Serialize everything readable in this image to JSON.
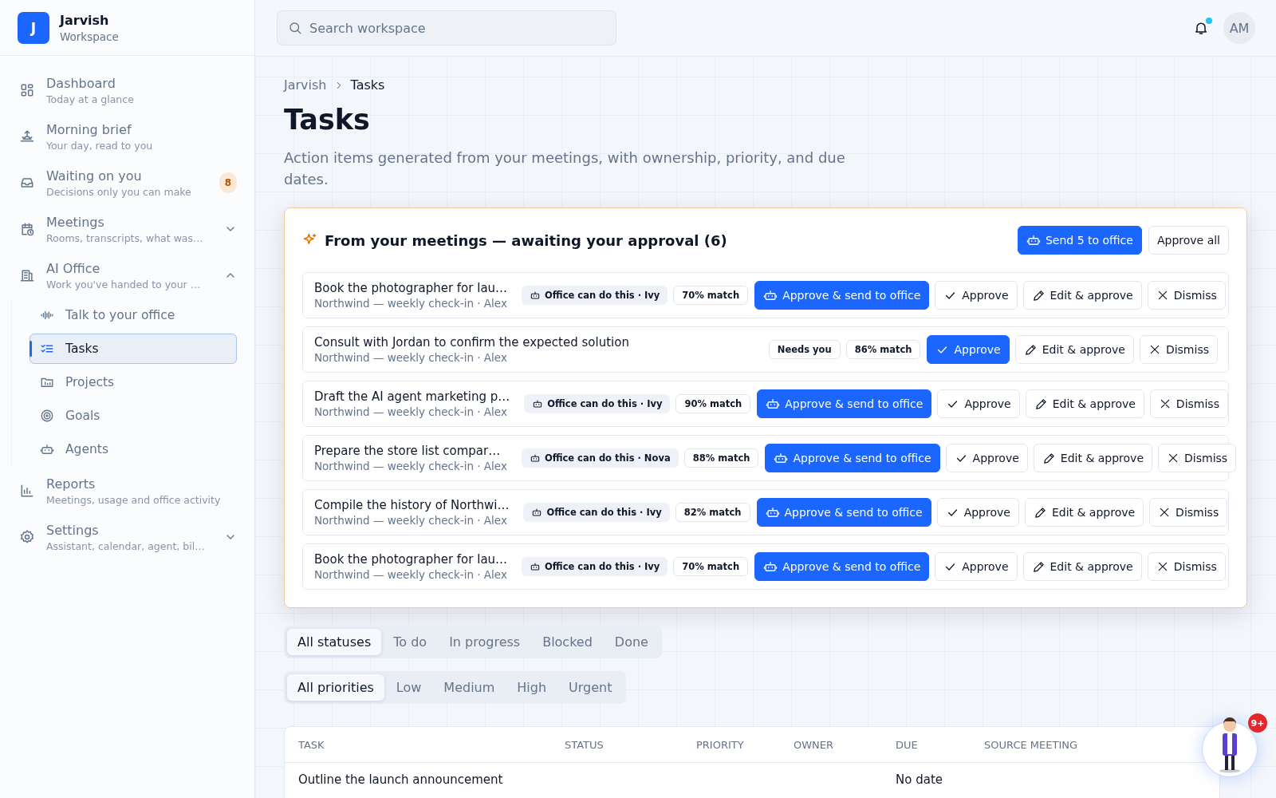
{
  "sidebar": {
    "brand": {
      "initial": "J",
      "name": "Jarvish",
      "subtitle": "Workspace"
    },
    "items": [
      {
        "label": "Dashboard",
        "description": "Today at a glance",
        "selected": false
      },
      {
        "label": "Morning brief",
        "description": "Your day, read to you",
        "selected": false
      },
      {
        "label": "Waiting on you",
        "description": "Decisions only you can make",
        "badge": "8",
        "selected": false
      },
      {
        "label": "Meetings",
        "description": "Rooms, transcripts, what was…",
        "expanded": false,
        "selected": false
      },
      {
        "label": "AI Office",
        "description": "Work you've handed to your …",
        "expanded": true,
        "selected": false,
        "children": [
          {
            "label": "Talk to your office",
            "selected": false
          },
          {
            "label": "Tasks",
            "selected": true
          },
          {
            "label": "Projects",
            "selected": false
          },
          {
            "label": "Goals",
            "selected": false
          },
          {
            "label": "Agents",
            "selected": false
          }
        ]
      },
      {
        "label": "Reports",
        "description": "Meetings, usage and office activity",
        "selected": false
      },
      {
        "label": "Settings",
        "description": "Assistant, calendar, agent, bil…",
        "expanded": false,
        "selected": false
      }
    ]
  },
  "topbar": {
    "search": {
      "placeholder": "Search workspace"
    },
    "notifications": {
      "unread": true
    },
    "avatar": "AM"
  },
  "breadcrumb": [
    "Jarvish",
    "Tasks"
  ],
  "title": "Tasks",
  "description": "Action items generated from your meetings, with ownership, priority, and due dates.",
  "approvals": {
    "title": "From your meetings — awaiting your approval (6)",
    "send_button": "Send 5 to office",
    "approve_all_button": "Approve all",
    "rows": [
      {
        "kind": "office",
        "title": "Book the photographer for lau…",
        "source": "Northwind — weekly check-in · Alex",
        "chip": "Office can do this · Ivy",
        "match": "70% match",
        "send_button": "Approve & send to office",
        "approve_button": "Approve",
        "edit_button": "Edit & approve",
        "dismiss_button": "Dismiss"
      },
      {
        "kind": "needs_you",
        "title": "Consult with Jordan to confirm the expected solution",
        "source": "Northwind — weekly check-in · Alex",
        "chip": "Needs you",
        "match": "86% match",
        "approve_button": "Approve",
        "edit_button": "Edit & approve",
        "dismiss_button": "Dismiss"
      },
      {
        "kind": "office",
        "title": "Draft the AI agent marketing p…",
        "source": "Northwind — weekly check-in · Alex",
        "chip": "Office can do this · Ivy",
        "match": "90% match",
        "send_button": "Approve & send to office",
        "approve_button": "Approve",
        "edit_button": "Edit & approve",
        "dismiss_button": "Dismiss"
      },
      {
        "kind": "office",
        "title": "Prepare the store list compar…",
        "source": "Northwind — weekly check-in · Alex",
        "chip": "Office can do this · Nova",
        "match": "88% match",
        "send_button": "Approve & send to office",
        "approve_button": "Approve",
        "edit_button": "Edit & approve",
        "dismiss_button": "Dismiss"
      },
      {
        "kind": "office",
        "title": "Compile the history of Northwi…",
        "source": "Northwind — weekly check-in · Alex",
        "chip": "Office can do this · Ivy",
        "match": "82% match",
        "send_button": "Approve & send to office",
        "approve_button": "Approve",
        "edit_button": "Edit & approve",
        "dismiss_button": "Dismiss"
      },
      {
        "kind": "office",
        "title": "Book the photographer for lau…",
        "source": "Northwind — weekly check-in · Alex",
        "chip": "Office can do this · Ivy",
        "match": "70% match",
        "send_button": "Approve & send to office",
        "approve_button": "Approve",
        "edit_button": "Edit & approve",
        "dismiss_button": "Dismiss"
      }
    ]
  },
  "status_filters": [
    {
      "label": "All statuses",
      "selected": true
    },
    {
      "label": "To do",
      "selected": false
    },
    {
      "label": "In progress",
      "selected": false
    },
    {
      "label": "Blocked",
      "selected": false
    },
    {
      "label": "Done",
      "selected": false
    }
  ],
  "priority_filters": [
    {
      "label": "All priorities",
      "selected": true
    },
    {
      "label": "Low",
      "selected": false
    },
    {
      "label": "Medium",
      "selected": false
    },
    {
      "label": "High",
      "selected": false
    },
    {
      "label": "Urgent",
      "selected": false
    }
  ],
  "table": {
    "columns": [
      "TASK",
      "STATUS",
      "PRIORITY",
      "OWNER",
      "DUE",
      "SOURCE MEETING"
    ],
    "rows": [
      {
        "task": "Outline the launch announcement",
        "due": "No date"
      }
    ]
  },
  "assistant": {
    "badge": "9+"
  }
}
